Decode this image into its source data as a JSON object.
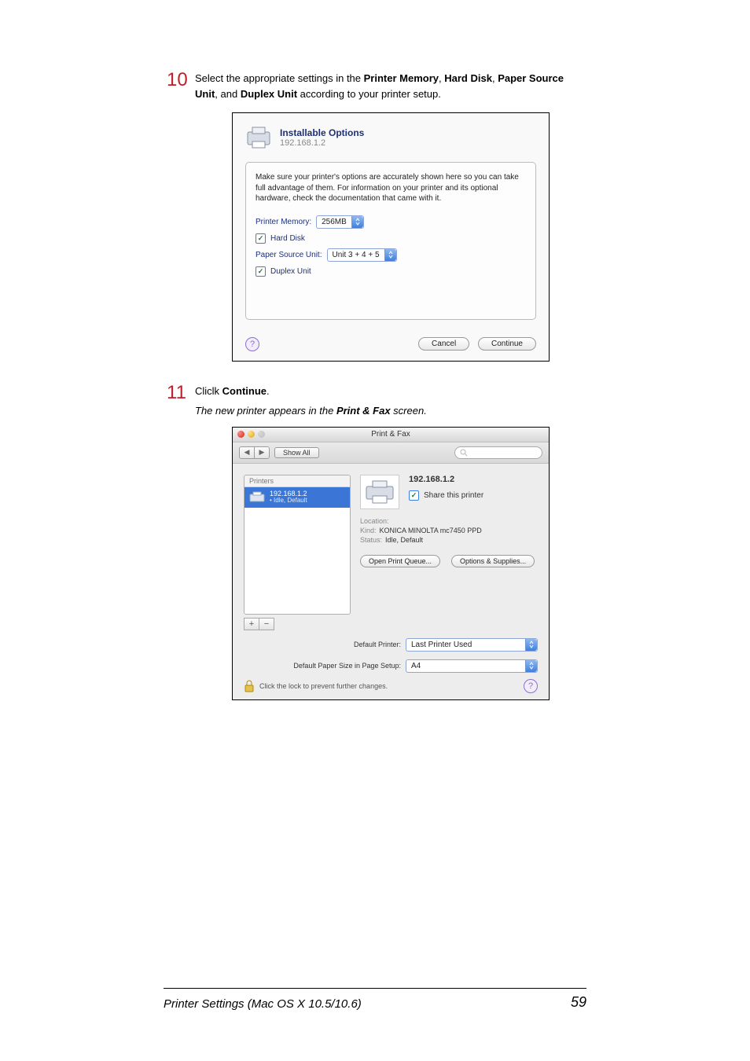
{
  "steps": {
    "s10": {
      "num": "10",
      "body_pre": "Select the appropriate settings in the ",
      "b1": "Printer Memory",
      "sep1": ", ",
      "b2": "Hard Disk",
      "sep2": ", ",
      "b3": "Paper Source Unit",
      "sep3": ", and ",
      "b4": "Duplex Unit",
      "tail": " according to your printer setup."
    },
    "s11": {
      "num": "11",
      "body_pre": "Cliclk ",
      "b1": "Continue",
      "tail": ".",
      "note": "The new printer appears in the Print & Fax screen."
    }
  },
  "dialog1": {
    "title": "Installable Options",
    "subtitle": "192.168.1.2",
    "desc": "Make sure your printer's options are accurately shown here so you can take full advantage of them. For information on your printer and its optional hardware, check the documentation that came with it.",
    "mem_label": "Printer Memory:",
    "mem_value": "256MB",
    "hd_label": "Hard Disk",
    "psu_label": "Paper Source Unit:",
    "psu_value": "Unit 3 + 4 + 5",
    "dup_label": "Duplex Unit",
    "cancel": "Cancel",
    "cont": "Continue",
    "help": "?"
  },
  "dialog2": {
    "title": "Print & Fax",
    "showall": "Show All",
    "printers_h": "Printers",
    "sel_name": "192.168.1.2",
    "sel_status": "• Idle, Default",
    "pr_name": "192.168.1.2",
    "share_label": "Share this printer",
    "loc_label": "Location:",
    "loc_value": "",
    "kind_label": "Kind:",
    "kind_value": "KONICA MINOLTA mc7450 PPD",
    "status_label": "Status:",
    "status_value": "Idle, Default",
    "open_queue": "Open Print Queue...",
    "opts": "Options & Supplies...",
    "defp_label": "Default Printer:",
    "defp_value": "Last Printer Used",
    "paper_label": "Default Paper Size in Page Setup:",
    "paper_value": "A4",
    "lock": "Click the lock to prevent further changes.",
    "help": "?",
    "plus": "+",
    "minus": "−",
    "back": "◀",
    "fwd": "▶"
  },
  "footer": {
    "title": "Printer Settings (Mac OS X 10.5/10.6)",
    "page": "59"
  }
}
